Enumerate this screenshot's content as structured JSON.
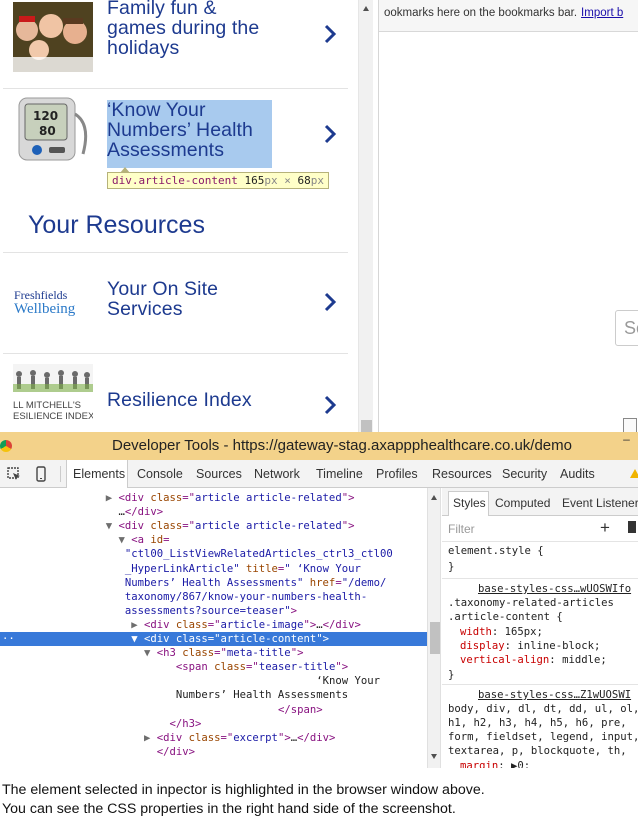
{
  "site": {
    "articles": [
      {
        "title_lines": [
          "Family fun &",
          "games during the",
          "holidays"
        ]
      },
      {
        "title_lines": [
          "‘Know Your",
          "Numbers’ Health",
          "Assessments"
        ]
      }
    ],
    "resources_heading": "Your Resources",
    "resources": [
      {
        "title_lines": [
          "Your On Site",
          "Services"
        ],
        "logo_line1": "Freshfields",
        "logo_line2": "Wellbeing"
      },
      {
        "title_lines": [
          "Resilience Index"
        ],
        "logo_line1": "LL MITCHELL'S",
        "logo_line2": "ESILIENCE INDEX"
      }
    ],
    "inspect_tooltip": {
      "selector": "div.article-content",
      "width": "165",
      "height": "68",
      "unit": "px",
      "times": "×"
    }
  },
  "browser": {
    "bookmarks_text": "ookmarks here on the bookmarks bar.",
    "bookmarks_link": "Import b",
    "search_placeholder": "Se"
  },
  "devtools": {
    "title": "Developer Tools - https://gateway-stag.axappphealthcare.co.uk/demo",
    "tabs": [
      "Elements",
      "Console",
      "Sources",
      "Network",
      "Timeline",
      "Profiles",
      "Resources",
      "Security",
      "Audits"
    ],
    "active_tab": "Elements",
    "dom_lines": [
      {
        "indent": 17,
        "tri": "▶",
        "parts": [
          [
            "tg",
            "<div "
          ],
          [
            "at",
            "class"
          ],
          [
            "tg",
            "=\""
          ],
          [
            "av",
            "article article-related"
          ],
          [
            "tg",
            "\">"
          ]
        ]
      },
      {
        "indent": 17,
        "tri": "",
        "parts": [
          [
            "tx",
            "…"
          ],
          [
            "tg",
            "</div>"
          ]
        ]
      },
      {
        "indent": 17,
        "tri": "▼",
        "parts": [
          [
            "tg",
            "<div "
          ],
          [
            "at",
            "class"
          ],
          [
            "tg",
            "=\""
          ],
          [
            "av",
            "article article-related"
          ],
          [
            "tg",
            "\">"
          ]
        ]
      },
      {
        "indent": 19,
        "tri": "▼",
        "parts": [
          [
            "tg",
            "<a "
          ],
          [
            "at",
            "id"
          ],
          [
            "tg",
            "="
          ]
        ]
      },
      {
        "indent": 18,
        "tri": "",
        "parts": [
          [
            "av",
            "\"ctl00_ListViewRelatedArticles_ctrl3_ctl00"
          ]
        ]
      },
      {
        "indent": 18,
        "tri": "",
        "parts": [
          [
            "av",
            "_HyperLinkArticle\" "
          ],
          [
            "at",
            "title"
          ],
          [
            "tg",
            "="
          ],
          [
            "av",
            "\" ‘Know Your"
          ]
        ]
      },
      {
        "indent": 18,
        "tri": "",
        "parts": [
          [
            "av",
            "Numbers’ Health Assessments\" "
          ],
          [
            "at",
            "href"
          ],
          [
            "tg",
            "="
          ],
          [
            "av",
            "\"/demo/"
          ]
        ]
      },
      {
        "indent": 18,
        "tri": "",
        "parts": [
          [
            "av",
            "taxonomy/867/know-your-numbers-health-"
          ]
        ]
      },
      {
        "indent": 18,
        "tri": "",
        "parts": [
          [
            "av",
            "assessments?source=teaser\""
          ],
          [
            "tg",
            ">"
          ]
        ]
      },
      {
        "indent": 21,
        "tri": "▶",
        "parts": [
          [
            "tg",
            "<div "
          ],
          [
            "at",
            "class"
          ],
          [
            "tg",
            "=\""
          ],
          [
            "av",
            "article-image"
          ],
          [
            "tg",
            "\">"
          ],
          [
            "tx",
            "…"
          ],
          [
            "tg",
            "</div>"
          ]
        ]
      },
      {
        "indent": 21,
        "tri": "▼",
        "sel": true,
        "parts": [
          [
            "tg",
            "<div "
          ],
          [
            "at",
            "class"
          ],
          [
            "tg",
            "=\""
          ],
          [
            "av",
            "article-content"
          ],
          [
            "tg",
            "\">"
          ]
        ]
      },
      {
        "indent": 23,
        "tri": "▼",
        "parts": [
          [
            "tg",
            "<h3 "
          ],
          [
            "at",
            "class"
          ],
          [
            "tg",
            "=\""
          ],
          [
            "av",
            "meta-title"
          ],
          [
            "tg",
            "\">"
          ]
        ]
      },
      {
        "indent": 26,
        "tri": "",
        "parts": [
          [
            "tg",
            "<span "
          ],
          [
            "at",
            "class"
          ],
          [
            "tg",
            "=\""
          ],
          [
            "av",
            "teaser-title"
          ],
          [
            "tg",
            "\">"
          ]
        ]
      },
      {
        "indent": 48,
        "tri": "",
        "parts": [
          [
            "tx",
            "‘Know Your"
          ]
        ]
      },
      {
        "indent": 26,
        "tri": "",
        "parts": [
          [
            "tx",
            "Numbers’ Health Assessments"
          ]
        ]
      },
      {
        "indent": 42,
        "tri": "",
        "parts": [
          [
            "tg",
            "</span>"
          ]
        ]
      },
      {
        "indent": 25,
        "tri": "",
        "parts": [
          [
            "tg",
            "</h3>"
          ]
        ]
      },
      {
        "indent": 23,
        "tri": "▶",
        "parts": [
          [
            "tg",
            "<div "
          ],
          [
            "at",
            "class"
          ],
          [
            "tg",
            "=\""
          ],
          [
            "av",
            "excerpt"
          ],
          [
            "tg",
            "\">"
          ],
          [
            "tx",
            "…"
          ],
          [
            "tg",
            "</div>"
          ]
        ]
      },
      {
        "indent": 23,
        "tri": "",
        "parts": [
          [
            "tg",
            "</div>"
          ]
        ]
      }
    ],
    "styles_tabs": [
      "Styles",
      "Computed",
      "Event Listeners"
    ],
    "filter_placeholder": "Filter",
    "element_style_open": "element.style {",
    "close_brace": "}",
    "rule1": {
      "source": "base-styles-css…wUOSWIfo",
      "selector_lines": [
        ".taxonomy-related-articles",
        ".article-content {"
      ],
      "props": [
        [
          "width",
          "165px;"
        ],
        [
          "display",
          "inline-block;"
        ],
        [
          "vertical-align",
          "middle;"
        ]
      ]
    },
    "rule2": {
      "source": "base-styles-css…Z1wUOSWI",
      "selector_lines": [
        "body, div, dl, dt, dd, ul, ol,",
        "h1, h2, h3, h4, h5, h6, pre,",
        "form, fieldset, legend, input,",
        "textarea, p, blockquote, th,"
      ],
      "props": [
        [
          "margin",
          "▶0;"
        ]
      ]
    }
  },
  "caption": {
    "line1": "The element selected in inpector is highlighted in the browser window above.",
    "line2": "You can see the CSS properties in the right hand side of the screenshot."
  }
}
